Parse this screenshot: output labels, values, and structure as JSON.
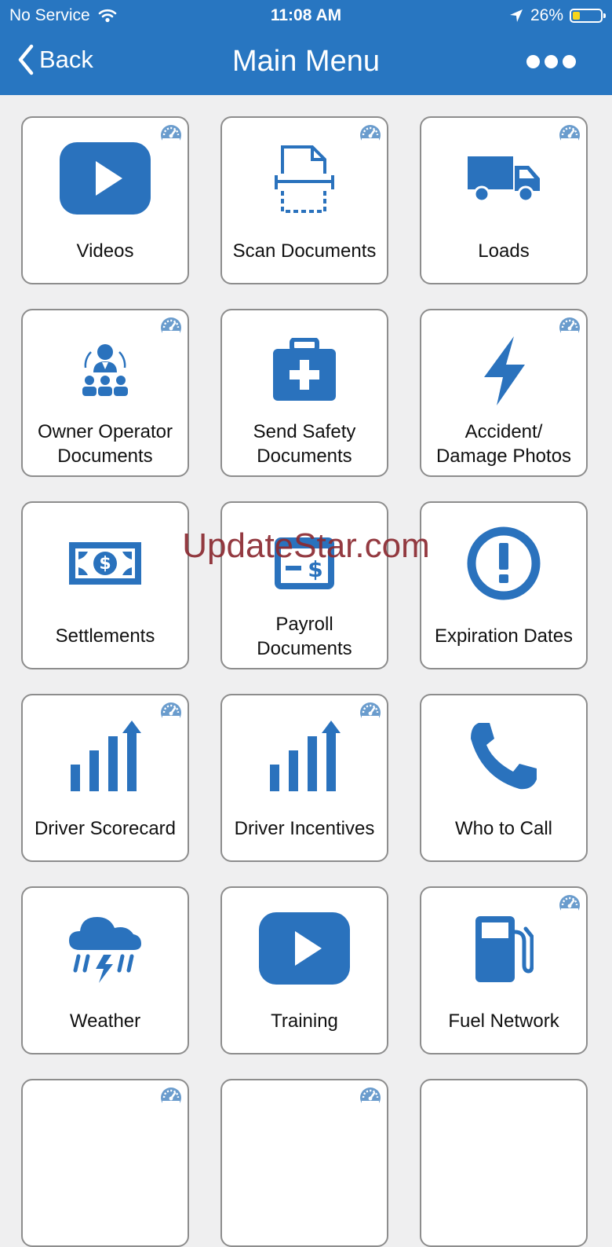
{
  "status_bar": {
    "carrier": "No Service",
    "time": "11:08 AM",
    "battery_percent": "26%"
  },
  "nav": {
    "back_label": "Back",
    "title": "Main Menu"
  },
  "watermark": "UpdateStar.com",
  "tiles": [
    {
      "label": "Videos",
      "icon": "video-play-icon"
    },
    {
      "label": "Scan Documents",
      "icon": "scan-document-icon"
    },
    {
      "label": "Loads",
      "icon": "truck-icon"
    },
    {
      "label_line1": "Owner Operator",
      "label_line2": "Documents",
      "icon": "team-icon"
    },
    {
      "label_line1": "Send Safety",
      "label_line2": "Documents",
      "icon": "first-aid-kit-icon"
    },
    {
      "label_line1": "Accident/",
      "label_line2": "Damage Photos",
      "icon": "lightning-icon"
    },
    {
      "label": "Settlements",
      "icon": "money-bill-icon"
    },
    {
      "label_line1": "Payroll",
      "label_line2": "Documents",
      "icon": "check-dollar-icon"
    },
    {
      "label": "Expiration Dates",
      "icon": "exclamation-circle-icon"
    },
    {
      "label": "Driver Scorecard",
      "icon": "bar-chart-up-icon"
    },
    {
      "label": "Driver Incentives",
      "icon": "bar-chart-up-icon"
    },
    {
      "label": "Who to Call",
      "icon": "phone-icon"
    },
    {
      "label": "Weather",
      "icon": "storm-cloud-icon"
    },
    {
      "label": "Training",
      "icon": "video-play-icon"
    },
    {
      "label": "Fuel Network",
      "icon": "fuel-pump-icon"
    }
  ],
  "colors": {
    "brand": "#2876c1",
    "icon": "#2a72bd",
    "badge": "#6a9ccd",
    "background": "#efeff0"
  }
}
